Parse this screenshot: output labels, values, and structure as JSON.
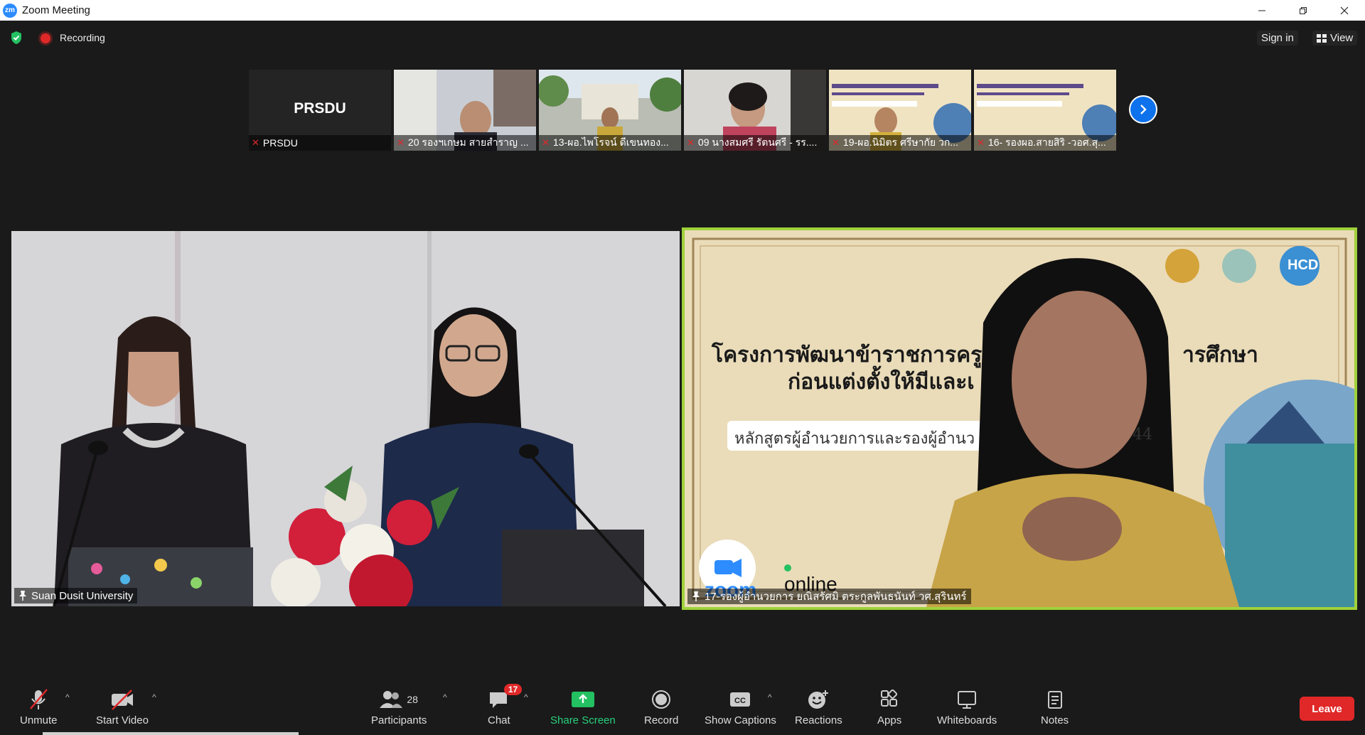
{
  "window": {
    "title": "Zoom Meeting",
    "logo_text": "zm"
  },
  "infobar": {
    "recording_label": "Recording",
    "signin_label": "Sign in",
    "view_label": "View"
  },
  "strip": {
    "tiles": [
      {
        "name": "PRSDU",
        "big": "PRSDU"
      },
      {
        "name": "20 รองฯเกษม สายสำราญ ..."
      },
      {
        "name": "13-ผอ.ไพโรจน์ ดีเขนทอง..."
      },
      {
        "name": "09 นางสมศรี รัตนศรี - รร...."
      },
      {
        "name": "19-ผอ.นิมิตร ศรีษากัย  วก..."
      },
      {
        "name": "16- รองผอ.สายสิริ -วอศ.สุ..."
      }
    ]
  },
  "videos": {
    "left_name": "Suan Dusit University",
    "right_name": "17-รองผู้อำนวยการ ยณิสรัศมิ ตระกูลพันธนันท์ วศ.สุรินทร์",
    "slide_title_1": "โครงการพัฒนาข้าราชการครู",
    "slide_title_1b": "ารศึกษา",
    "slide_title_2": "ก่อนแต่งตั้งให้มีและเ",
    "slide_subtitle": "หลักสูตรผู้อำนวยการและรองผู้อำนว",
    "slide_subtitle_num": "44",
    "slide_logo_text": "HCD",
    "zoom_word": "zoom",
    "online_word": "online"
  },
  "toolbar": {
    "unmute": "Unmute",
    "start_video": "Start Video",
    "participants": "Participants",
    "participants_count": "28",
    "chat": "Chat",
    "chat_badge": "17",
    "share": "Share Screen",
    "record": "Record",
    "captions": "Show Captions",
    "reactions": "Reactions",
    "apps": "Apps",
    "whiteboards": "Whiteboards",
    "notes": "Notes",
    "leave": "Leave"
  }
}
